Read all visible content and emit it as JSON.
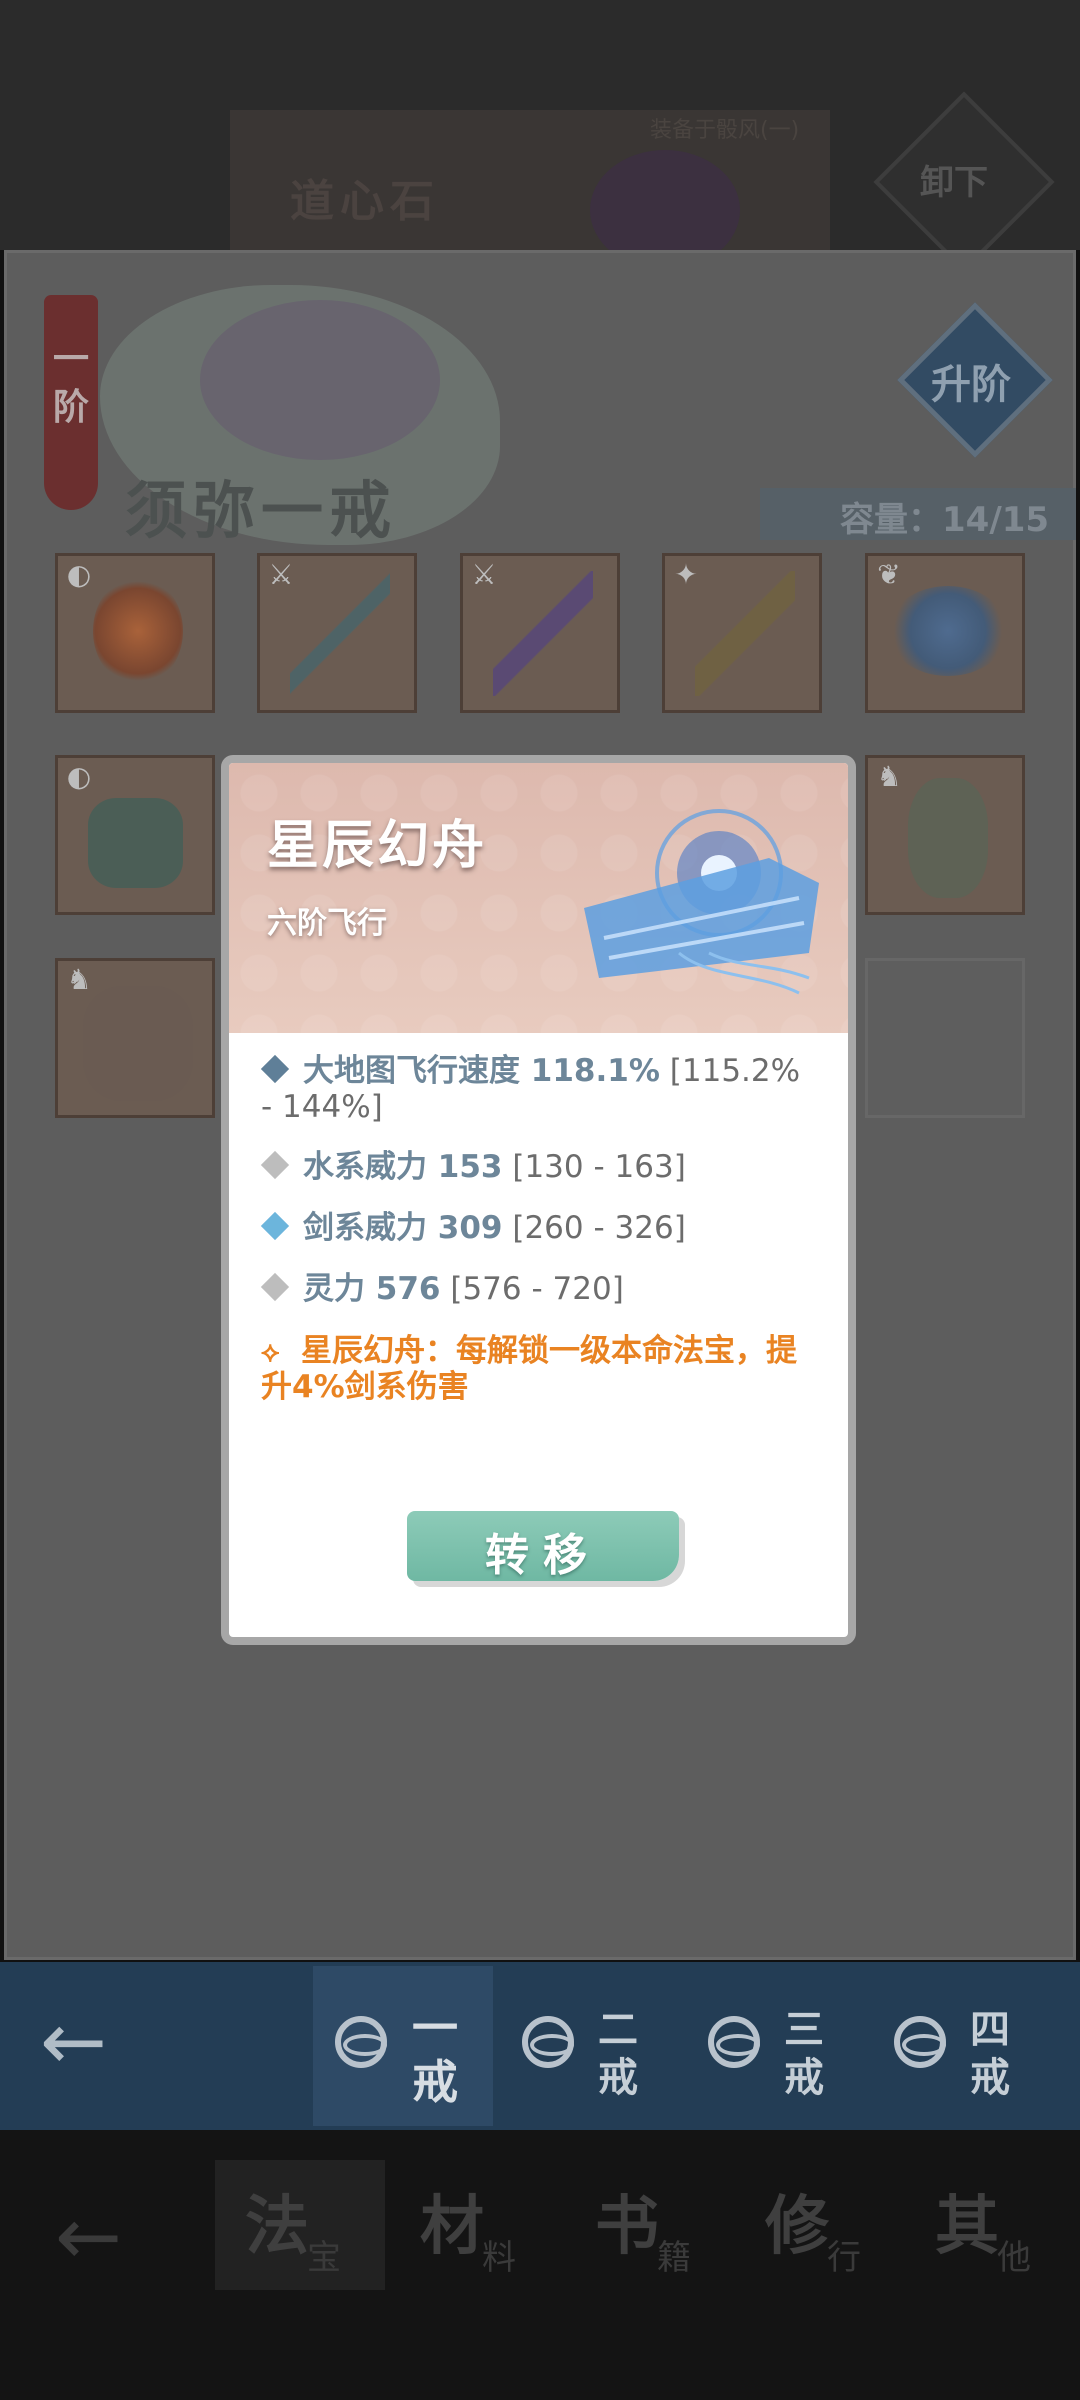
{
  "background": {
    "stone_title": "道心石",
    "banner_small": "装备于骰风(一)",
    "unequip_label": "卸下"
  },
  "panel": {
    "tier_label": "一阶",
    "ring_name": "须弥一戒",
    "capacity": "容量：14/15",
    "upgrade_label": "升阶"
  },
  "dialog": {
    "title": "星辰幻舟",
    "subtitle": "六阶飞行",
    "stats": [
      {
        "name": "大地图飞行速度 118.1%",
        "range": " [115.2% - 144%]",
        "bullet_color": "#5f7f98"
      },
      {
        "name": "水系威力 153",
        "range": " [130 - 163]",
        "bullet_color": "#bdbdbd"
      },
      {
        "name": "剑系威力 309",
        "range": " [260 - 326]",
        "bullet_color": "#6cb5dc"
      },
      {
        "name": "灵力 576",
        "range": " [576 - 720]",
        "bullet_color": "#bdbdbd"
      }
    ],
    "set_effect": "星辰幻舟：每解锁一级本命法宝，提升4%剑系伤害",
    "transfer_label": "转移"
  },
  "ring_tabs": [
    {
      "label": "一戒",
      "active": true
    },
    {
      "label": "二戒",
      "active": false
    },
    {
      "label": "三戒",
      "active": false
    },
    {
      "label": "四戒",
      "active": false
    }
  ],
  "bottom_nav": [
    {
      "big": "法",
      "small": "宝"
    },
    {
      "big": "材",
      "small": "料"
    },
    {
      "big": "书",
      "small": "籍"
    },
    {
      "big": "修",
      "small": "行"
    },
    {
      "big": "其",
      "small": "他"
    }
  ],
  "colors": {
    "stat_name": "#6d8699",
    "set_effect": "#e98322",
    "transfer_button": "#7cc1ad",
    "dialog_header": "#e2c2b6"
  },
  "icons": {
    "back": "arrow-left-icon",
    "ring": "ring-icon",
    "set": "set-link-icon"
  }
}
